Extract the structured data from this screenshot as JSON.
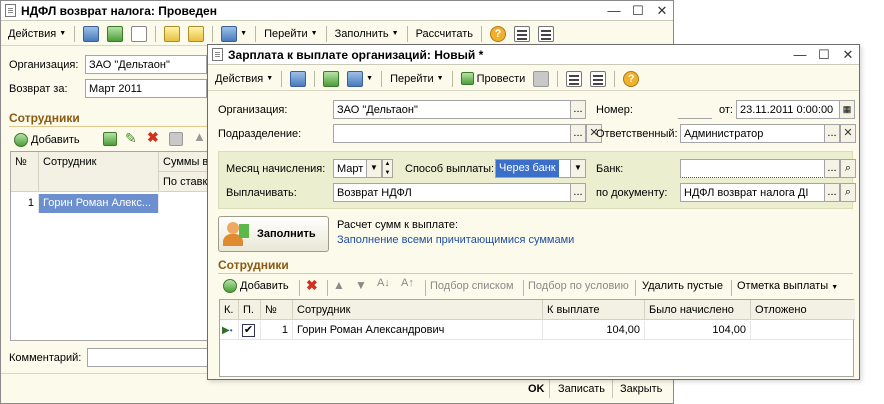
{
  "back_window": {
    "title": "НДФЛ возврат налога: Проведен",
    "toolbar": {
      "actions": "Действия",
      "goto": "Перейти",
      "fill": "Заполнить",
      "calc": "Рассчитать"
    },
    "org_label": "Организация:",
    "org_value": "ЗАО \"Дельтаон\"",
    "return_label": "Возврат за:",
    "return_value": "Март 2011",
    "employees_title": "Сотрудники",
    "add_label": "Добавить",
    "grid": {
      "col_num": "№",
      "col_employee": "Сотрудник",
      "col_sums": "Суммы в",
      "col_rate": "По ставк",
      "rows": [
        {
          "num": "1",
          "employee": "Горин Роман Алекс..."
        }
      ]
    },
    "comment_label": "Комментарий:",
    "ok": "OK",
    "write": "Записать",
    "close": "Закрыть"
  },
  "front_window": {
    "title": "Зарплата к выплате организаций: Новый *",
    "toolbar": {
      "actions": "Действия",
      "goto": "Перейти",
      "post": "Провести"
    },
    "org_label": "Организация:",
    "org_value": "ЗАО \"Дельтаон\"",
    "number_label": "Номер:",
    "from_label": "от:",
    "date_value": "23.11.2011  0:00:00",
    "division_label": "Подразделение:",
    "responsible_label": "Ответственный:",
    "responsible_value": "Администратор",
    "month_label": "Месяц начисления:",
    "month_value": "Март",
    "pay_method_label": "Способ выплаты:",
    "pay_method_value": "Через банк",
    "bank_label": "Банк:",
    "pay_label": "Выплачивать:",
    "pay_value": "Возврат НДФЛ",
    "by_doc_label": "по документу:",
    "by_doc_value": "НДФЛ возврат налога ДI",
    "fill_button": "Заполнить",
    "calc_caption": "Расчет сумм к выплате:",
    "calc_link": "Заполнение всеми причитающимися суммами",
    "employees_title": "Сотрудники",
    "emp_toolbar": {
      "add": "Добавить",
      "pick_list": "Подбор списком",
      "pick_cond": "Подбор по условию",
      "delete_empty": "Удалить пустые",
      "mark_pay": "Отметка выплаты"
    },
    "grid": {
      "col_k": "К.",
      "col_p": "П.",
      "col_num": "№",
      "col_employee": "Сотрудник",
      "col_to_pay": "К выплате",
      "col_accrued": "Было начислено",
      "col_deferred": "Отложено",
      "rows": [
        {
          "num": "1",
          "employee": "Горин Роман Александрович",
          "to_pay": "104,00",
          "accrued": "104,00",
          "deferred": "",
          "checked": true
        }
      ]
    }
  }
}
